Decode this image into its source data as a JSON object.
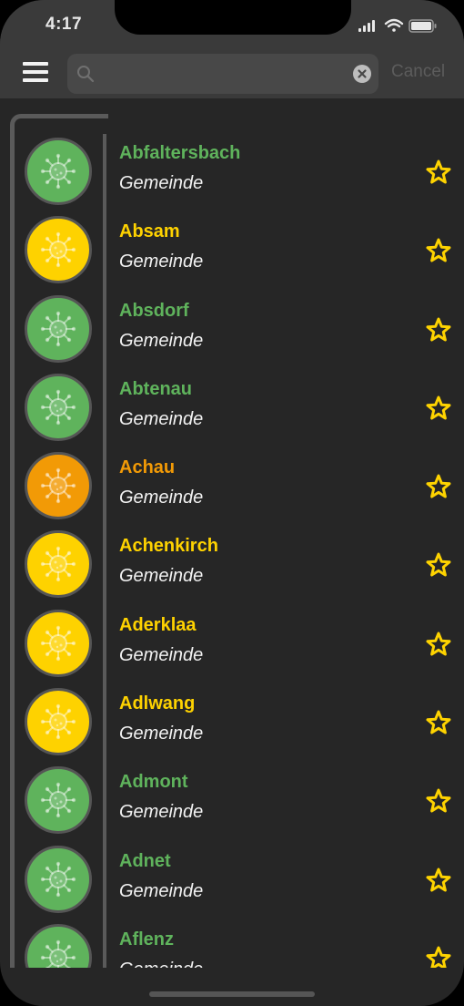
{
  "status_bar": {
    "time": "4:17"
  },
  "search": {
    "placeholder": "",
    "value": "",
    "cancel_label": "Cancel"
  },
  "colors": {
    "green": "#5fb35c",
    "yellow": "#fed200",
    "orange": "#f29a06",
    "star": "#fed300"
  },
  "list": [
    {
      "name": "Abfaltersbach",
      "type": "Gemeinde",
      "level": "green"
    },
    {
      "name": "Absam",
      "type": "Gemeinde",
      "level": "yellow"
    },
    {
      "name": "Absdorf",
      "type": "Gemeinde",
      "level": "green"
    },
    {
      "name": "Abtenau",
      "type": "Gemeinde",
      "level": "green"
    },
    {
      "name": "Achau",
      "type": "Gemeinde",
      "level": "orange"
    },
    {
      "name": "Achenkirch",
      "type": "Gemeinde",
      "level": "yellow"
    },
    {
      "name": "Aderklaa",
      "type": "Gemeinde",
      "level": "yellow"
    },
    {
      "name": "Adlwang",
      "type": "Gemeinde",
      "level": "yellow"
    },
    {
      "name": "Admont",
      "type": "Gemeinde",
      "level": "green"
    },
    {
      "name": "Adnet",
      "type": "Gemeinde",
      "level": "green"
    },
    {
      "name": "Aflenz",
      "type": "Gemeinde",
      "level": "green"
    }
  ]
}
